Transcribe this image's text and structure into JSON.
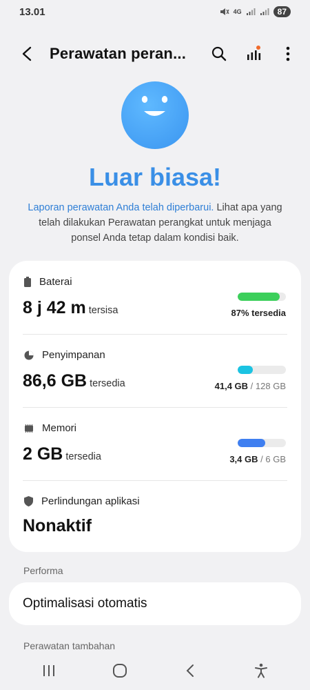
{
  "status_bar": {
    "time": "13.01",
    "network_label": "4G",
    "battery": "87"
  },
  "header": {
    "title": "Perawatan peran..."
  },
  "hero": {
    "title": "Luar biasa!",
    "desc_link": "Laporan perawatan Anda telah diperbarui.",
    "desc_rest": " Lihat apa yang telah dilakukan Perawatan perangkat untuk menjaga ponsel Anda tetap dalam kondisi baik."
  },
  "status_card": {
    "battery": {
      "label": "Baterai",
      "value": "8 j 42 m",
      "suffix": "tersisa",
      "right_strong": "87% tersedia",
      "fill_fraction": 0.87,
      "color": "#3ccf5b"
    },
    "storage": {
      "label": "Penyimpanan",
      "value": "86,6 GB",
      "suffix": "tersedia",
      "used": "41,4 GB",
      "total": "128 GB",
      "fill_fraction": 0.32,
      "color": "#1bc3e2"
    },
    "memory": {
      "label": "Memori",
      "value": "2 GB",
      "suffix": "tersedia",
      "used": "3,4 GB",
      "total": "6 GB",
      "fill_fraction": 0.57,
      "color": "#3f7ff0"
    },
    "protection": {
      "label": "Perlindungan aplikasi",
      "value": "Nonaktif"
    }
  },
  "performance": {
    "section_title": "Performa",
    "item_label": "Optimalisasi otomatis"
  },
  "extra": {
    "section_title": "Perawatan tambahan"
  },
  "icons": {
    "back": "back-arrow-icon",
    "search": "search-icon",
    "stats": "bar-chart-icon",
    "more": "more-vert-icon"
  }
}
